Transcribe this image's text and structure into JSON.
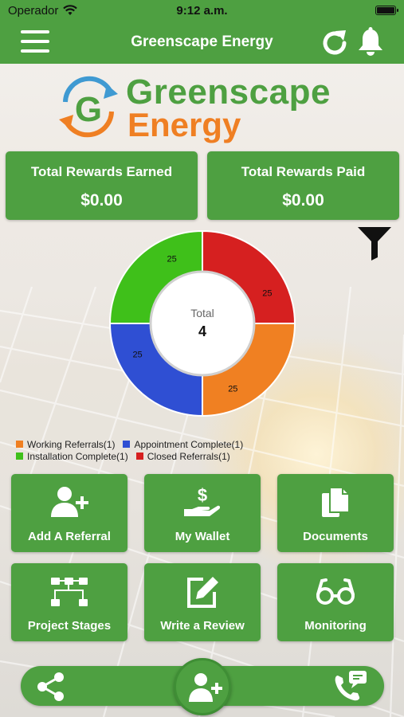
{
  "status_bar": {
    "carrier": "Operador",
    "time": "9:12 a.m."
  },
  "header": {
    "title": "Greenscape Energy",
    "icons": {
      "menu": "hamburger-menu-icon",
      "refresh": "refresh-icon",
      "notifications": "bell-icon"
    }
  },
  "logo": {
    "line1": "Greenscape",
    "line2": "Energy",
    "mark_letter": "G"
  },
  "rewards": {
    "earned": {
      "label": "Total Rewards Earned",
      "value": "$0.00"
    },
    "paid": {
      "label": "Total Rewards Paid",
      "value": "$0.00"
    }
  },
  "filter": {
    "icon": "filter-icon"
  },
  "chart_data": {
    "type": "pie",
    "subtype": "donut",
    "center_label": "Total",
    "center_value": "4",
    "slices": [
      {
        "name": "Closed Referrals(1)",
        "value": 25,
        "label": "25",
        "color": "#d62020"
      },
      {
        "name": "Working Referrals(1)",
        "value": 25,
        "label": "25",
        "color": "#f08022"
      },
      {
        "name": "Appointment Complete(1)",
        "value": 25,
        "label": "25",
        "color": "#2f4fd3"
      },
      {
        "name": "Installation Complete(1)",
        "value": 25,
        "label": "25",
        "color": "#3fc01a"
      }
    ],
    "legend": [
      [
        "Working Referrals(1)",
        "Appointment Complete(1)"
      ],
      [
        "Installation Complete(1)",
        "Closed Referrals(1)"
      ]
    ]
  },
  "tiles": [
    {
      "label": "Add A Referral",
      "icon": "add-user-icon"
    },
    {
      "label": "My Wallet",
      "icon": "wallet-hand-dollar-icon"
    },
    {
      "label": "Documents",
      "icon": "documents-icon"
    },
    {
      "label": "Project Stages",
      "icon": "project-stages-icon"
    },
    {
      "label": "Write a Review",
      "icon": "write-review-icon"
    },
    {
      "label": "Monitoring",
      "icon": "glasses-icon"
    }
  ],
  "bottom_bar": {
    "share_icon": "share-icon",
    "fab_icon": "add-user-icon",
    "call_icon": "phone-chat-icon"
  },
  "colors": {
    "brand_green": "#4ea041",
    "brand_orange": "#ef7f23"
  }
}
